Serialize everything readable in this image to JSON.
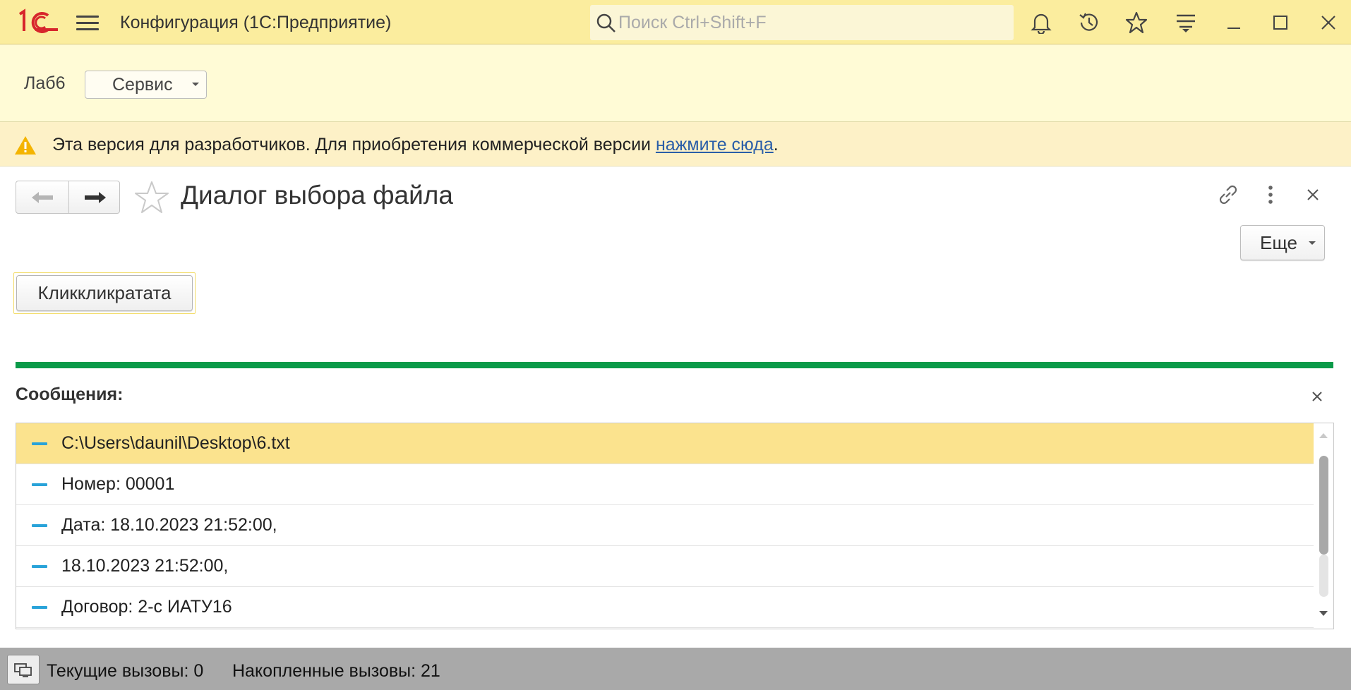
{
  "titlebar": {
    "app_title": "Конфигурация  (1С:Предприятие)",
    "search_placeholder": "Поиск Ctrl+Shift+F",
    "brand_color": "#d7262c",
    "background": "#fbed9e",
    "icons": [
      "logo-1c",
      "menu-icon",
      "search-icon",
      "bell-icon",
      "history-icon",
      "star-icon",
      "functions-menu-icon",
      "minimize-icon",
      "maximize-icon",
      "close-icon"
    ]
  },
  "section_panel": {
    "section_label": "Лаб6",
    "service_menu_label": "Сервис"
  },
  "warning": {
    "text": "Эта версия для разработчиков. Для приобретения коммерческой версии ",
    "link_text": "нажмите сюда",
    "suffix": "."
  },
  "form": {
    "title": "Диалог выбора файла",
    "more_label": "Еще",
    "click_button_label": "Клик­кликратата"
  },
  "messages": {
    "title": "Сообщения:",
    "accent_color": "#0a9a49",
    "items": [
      {
        "text": "C:\\Users\\daunil\\Desktop\\6.txt",
        "selected": true
      },
      {
        "text": "Номер: 00001",
        "selected": false
      },
      {
        "text": "Дата: 18.10.2023 21:52:00,",
        "selected": false
      },
      {
        "text": "18.10.2023 21:52:00,",
        "selected": false
      },
      {
        "text": "Договор: 2-с ИАТУ16",
        "selected": false
      }
    ]
  },
  "statusbar": {
    "current_calls": "Текущие вызовы: 0",
    "accumulated_calls": "Накопленные вызовы: 21"
  }
}
